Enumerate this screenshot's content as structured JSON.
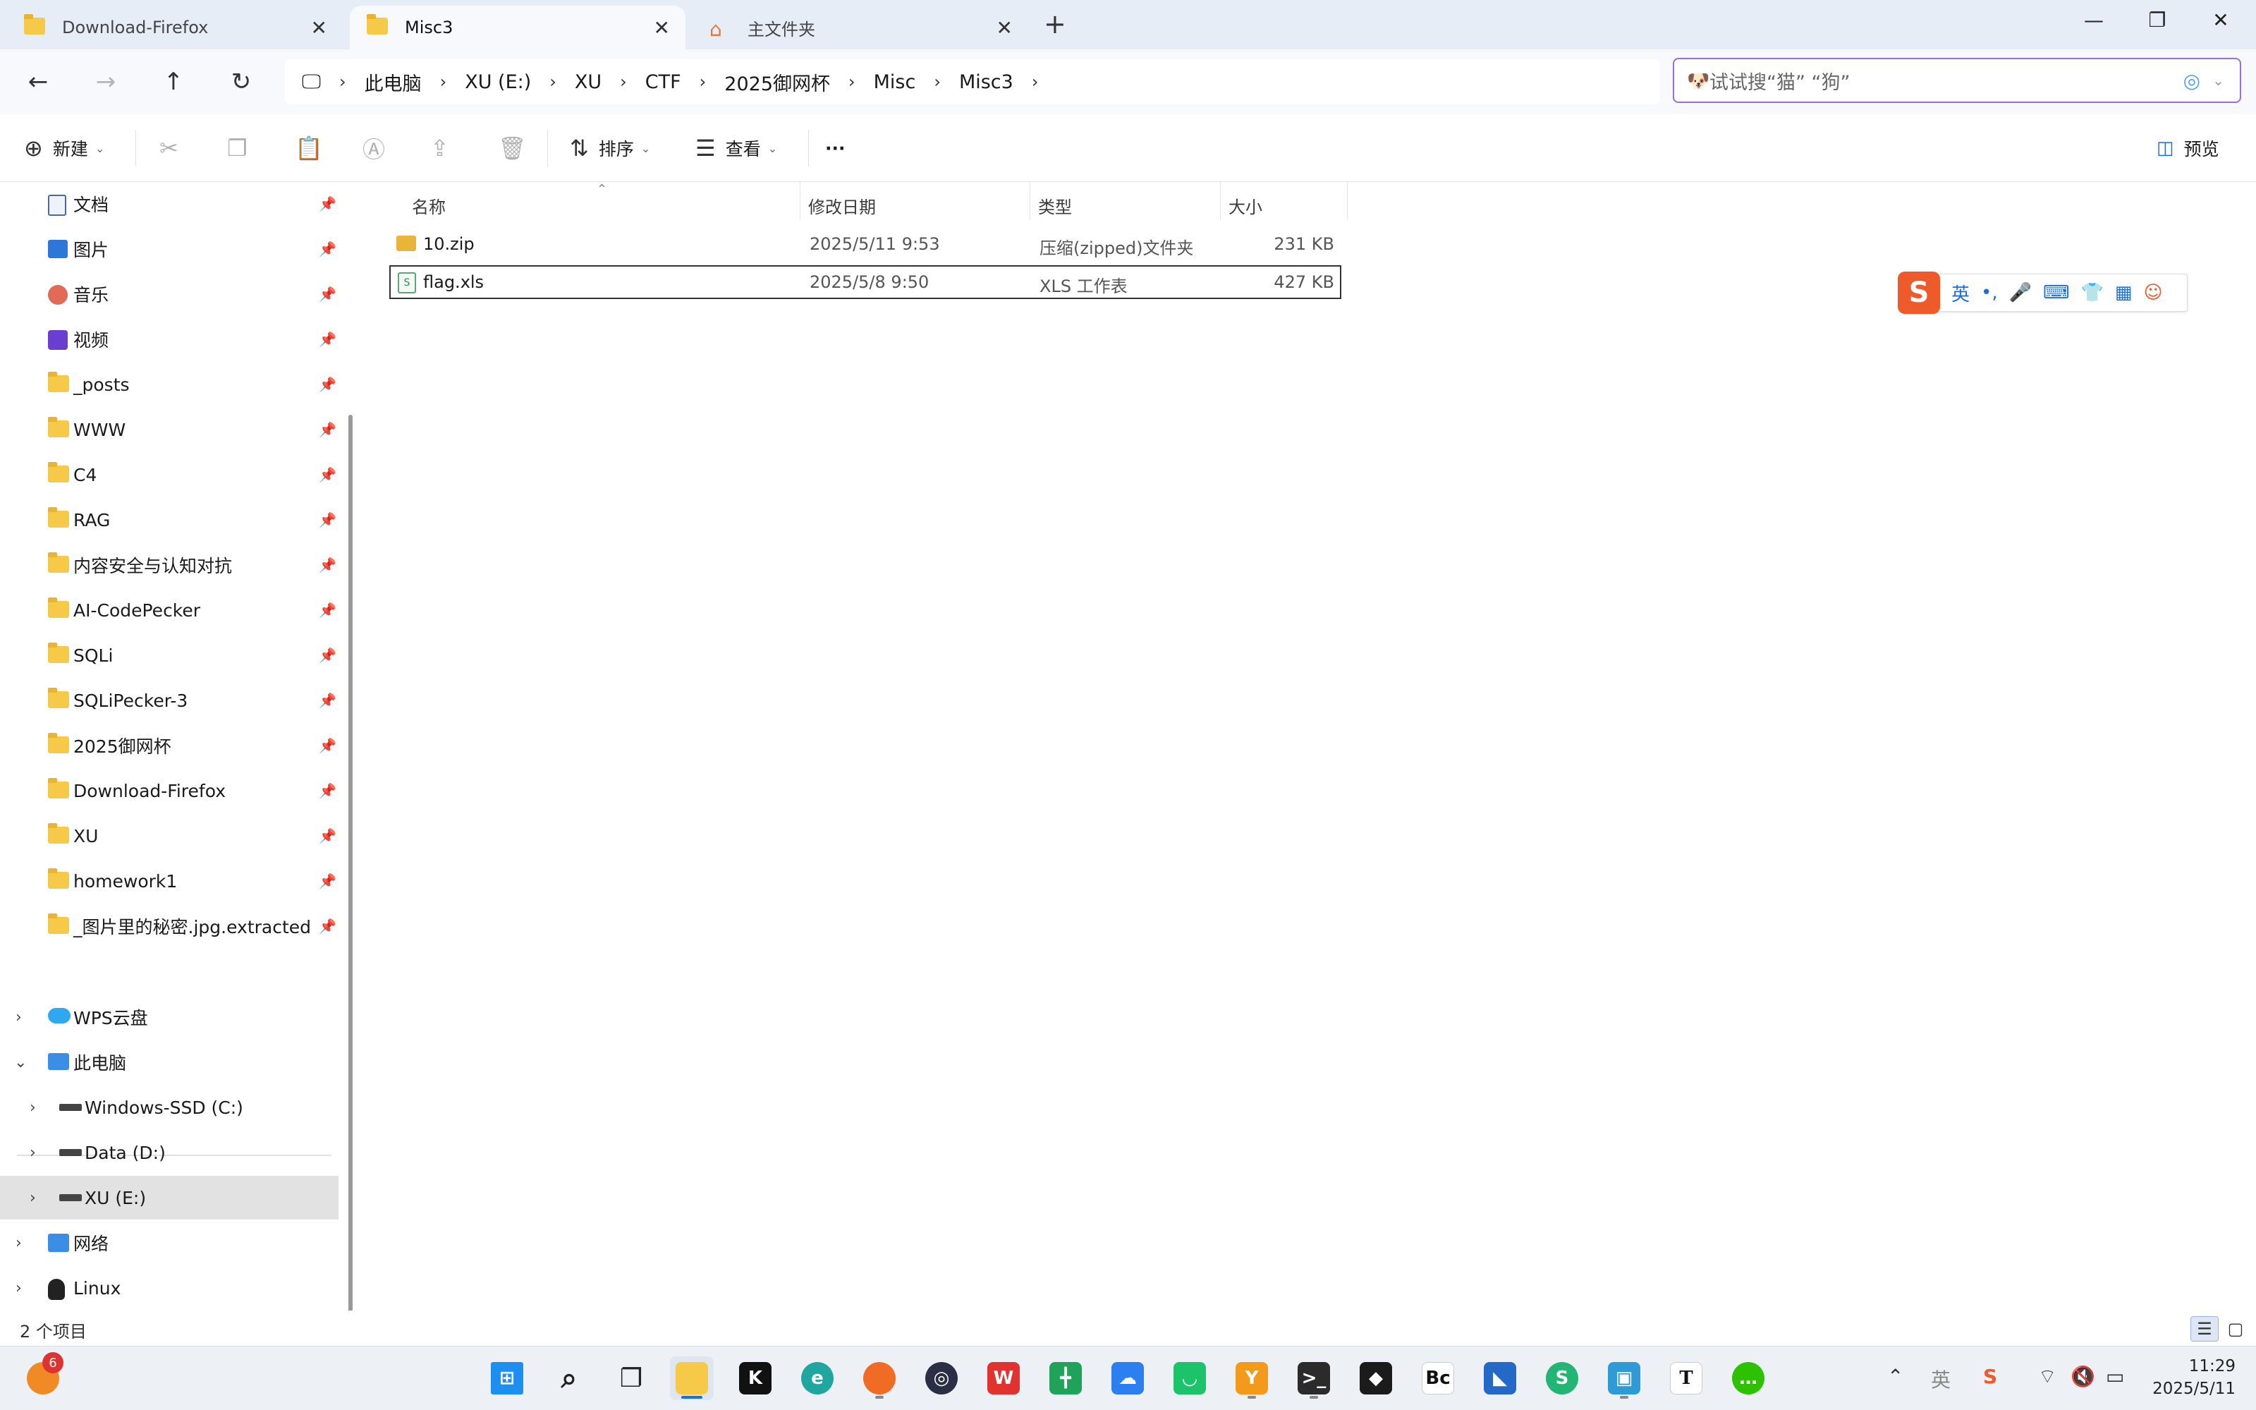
{
  "tabs": [
    {
      "label": "Download-Firefox",
      "icon": "folder-icon",
      "active": false
    },
    {
      "label": "Misc3",
      "icon": "folder-icon",
      "active": true
    },
    {
      "label": "主文件夹",
      "icon": "home-icon",
      "active": false
    }
  ],
  "new_tab_label": "+",
  "window_controls": {
    "minimize": "—",
    "restore": "❐",
    "close": "✕"
  },
  "nav": {
    "back": "←",
    "forward": "→",
    "up": "↑",
    "refresh": "↻"
  },
  "breadcrumb": [
    "此电脑",
    "XU (E:)",
    "XU",
    "CTF",
    "2025御网杯",
    "Misc",
    "Misc3"
  ],
  "search": {
    "placeholder": "试试搜“猫” “狗”"
  },
  "commands": {
    "new": "新建",
    "sort": "排序",
    "view": "查看",
    "more": "···",
    "preview": "预览"
  },
  "sidebar": {
    "quick_access": [
      {
        "label": "文档",
        "icon": "document-icon"
      },
      {
        "label": "图片",
        "icon": "pictures-icon"
      },
      {
        "label": "音乐",
        "icon": "music-icon"
      },
      {
        "label": "视频",
        "icon": "video-icon"
      },
      {
        "label": "_posts",
        "icon": "folder-icon"
      },
      {
        "label": "WWW",
        "icon": "folder-icon"
      },
      {
        "label": "C4",
        "icon": "folder-icon"
      },
      {
        "label": "RAG",
        "icon": "folder-icon"
      },
      {
        "label": "内容安全与认知对抗",
        "icon": "folder-icon"
      },
      {
        "label": "AI-CodePecker",
        "icon": "folder-icon"
      },
      {
        "label": "SQLi",
        "icon": "folder-icon"
      },
      {
        "label": "SQLiPecker-3",
        "icon": "folder-icon"
      },
      {
        "label": "2025御网杯",
        "icon": "folder-icon"
      },
      {
        "label": "Download-Firefox",
        "icon": "folder-icon"
      },
      {
        "label": "XU",
        "icon": "folder-icon"
      },
      {
        "label": "homework1",
        "icon": "folder-icon"
      },
      {
        "label": "_图片里的秘密.jpg.extracted",
        "icon": "folder-icon"
      }
    ],
    "tree": [
      {
        "label": "WPS云盘",
        "icon": "cloud-icon"
      },
      {
        "label": "此电脑",
        "icon": "computer-icon"
      },
      {
        "label": "Windows-SSD (C:)",
        "icon": "drive-icon"
      },
      {
        "label": "Data (D:)",
        "icon": "drive-icon"
      },
      {
        "label": "XU (E:)",
        "icon": "drive-icon"
      },
      {
        "label": "网络",
        "icon": "network-icon"
      },
      {
        "label": "Linux",
        "icon": "linux-icon"
      }
    ]
  },
  "columns": {
    "name": "名称",
    "modified": "修改日期",
    "type": "类型",
    "size": "大小"
  },
  "files": [
    {
      "name": "10.zip",
      "modified": "2025/5/11 9:53",
      "type": "压缩(zipped)文件夹",
      "size": "231 KB",
      "icon": "zip-icon"
    },
    {
      "name": "flag.xls",
      "modified": "2025/5/8 9:50",
      "type": "XLS 工作表",
      "size": "427 KB",
      "icon": "xls-icon"
    }
  ],
  "ime": {
    "logo": "S",
    "mode": "英",
    "punct": "•,"
  },
  "status": {
    "count": "2 个项目"
  },
  "taskbar": {
    "badge_count": "6",
    "apps": [
      "firefox-badge-icon",
      "windows-start-icon",
      "search-icon",
      "task-view-icon",
      "file-explorer-icon",
      "k-app-icon",
      "edge-icon",
      "firefox-icon",
      "app-icon",
      "wps-icon",
      "sheets-icon",
      "cloud-app-icon",
      "green-app-icon",
      "orange-app-icon",
      "terminal-icon",
      "app-dark-icon",
      "bc-app-icon",
      "app-blue-icon",
      "green-s-icon",
      "vmware-icon",
      "typora-icon",
      "wechat-icon"
    ],
    "tray_ime_label": "英",
    "clock_time": "11:29",
    "clock_date": "2025/5/11"
  },
  "colors": {
    "accent": "#1d6fd8",
    "folder": "#f7c948",
    "search_border": "#9b6be0"
  }
}
